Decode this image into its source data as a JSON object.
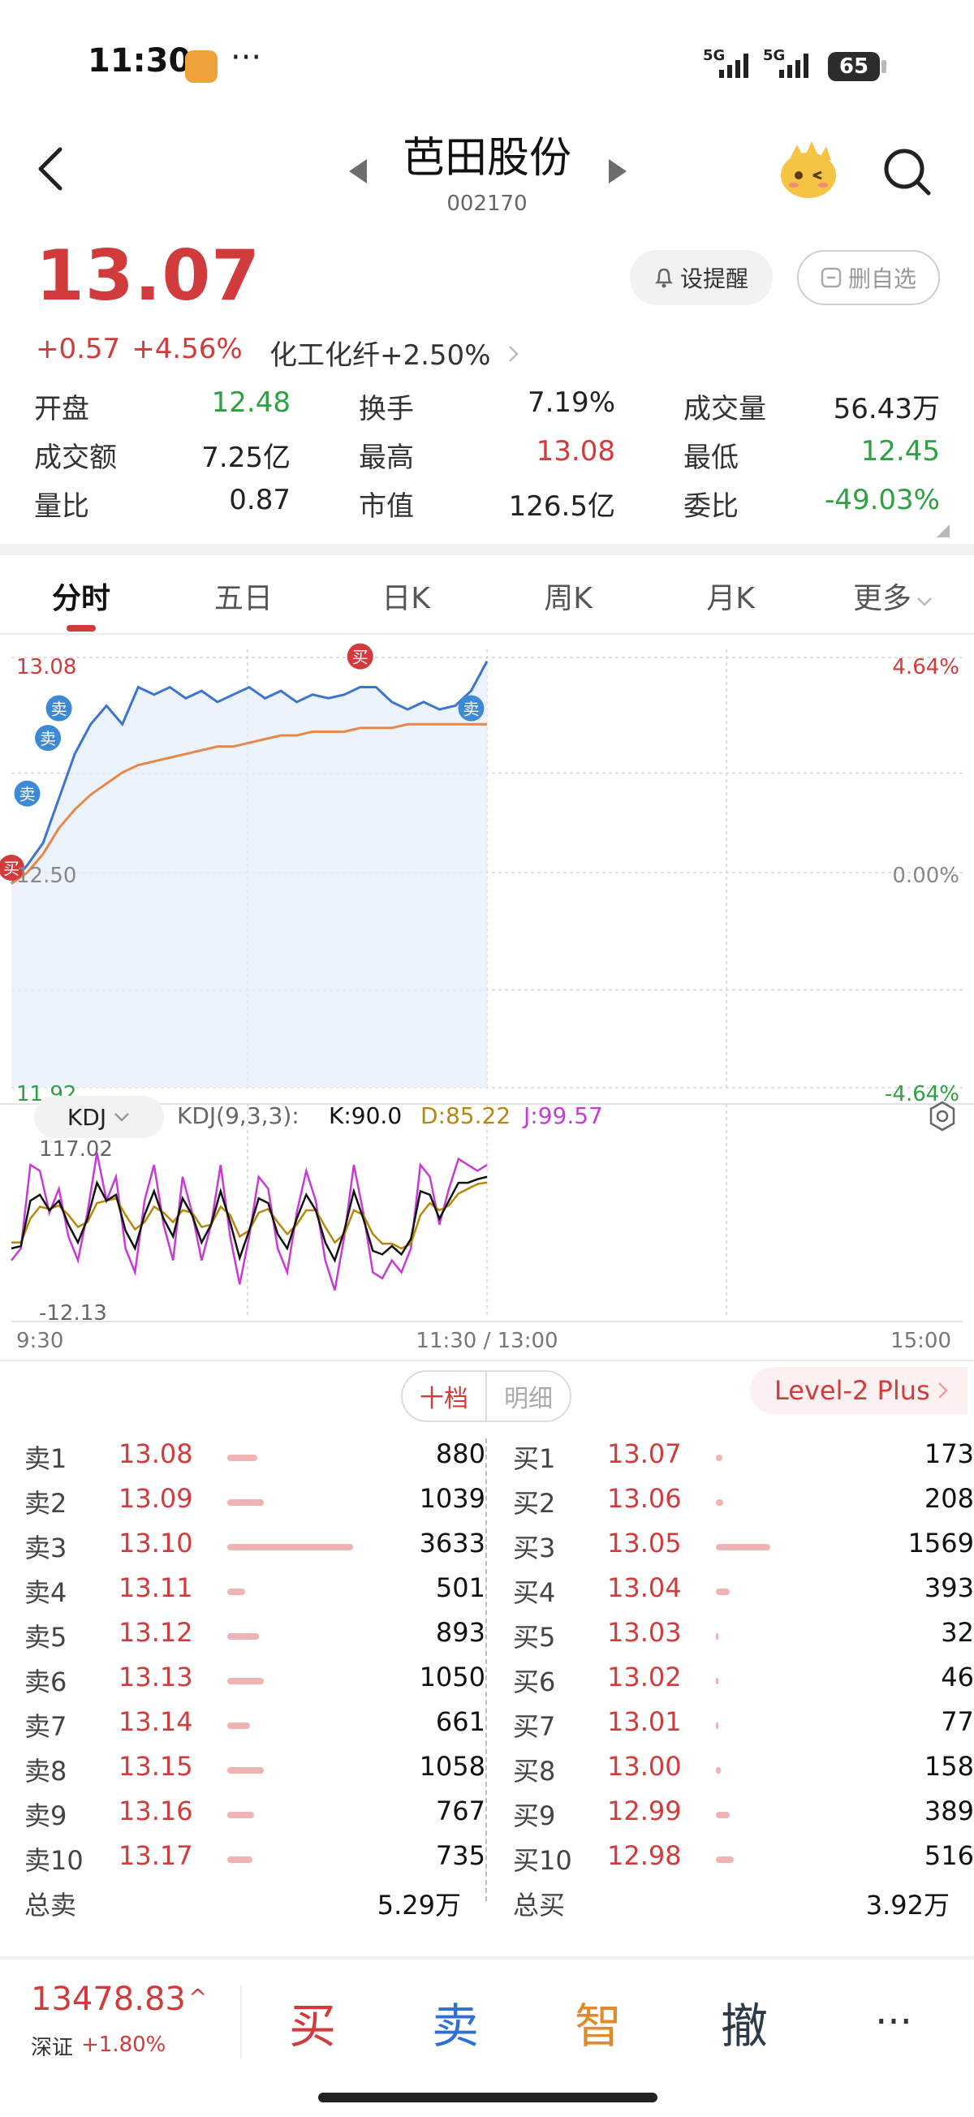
{
  "status": {
    "time": "11:30",
    "dots": "···",
    "net1": "5G",
    "net2": "5G",
    "battery": "65"
  },
  "header": {
    "name": "芭田股份",
    "code": "002170"
  },
  "price": {
    "last": "13.07",
    "change": "+0.57",
    "pct": "+4.56%",
    "sector": "化工化纤+2.50%",
    "alert_label": "设提醒",
    "watch_label": "删自选"
  },
  "quote": [
    {
      "label": "开盘",
      "value": "12.48",
      "color": "green"
    },
    {
      "label": "换手",
      "value": "7.19%",
      "color": "black"
    },
    {
      "label": "成交量",
      "value": "56.43万",
      "color": "black"
    },
    {
      "label": "成交额",
      "value": "7.25亿",
      "color": "black"
    },
    {
      "label": "最高",
      "value": "13.08",
      "color": "red"
    },
    {
      "label": "最低",
      "value": "12.45",
      "color": "green"
    },
    {
      "label": "量比",
      "value": "0.87",
      "color": "black"
    },
    {
      "label": "市值",
      "value": "126.5亿",
      "color": "black"
    },
    {
      "label": "委比",
      "value": "-49.03%",
      "color": "green"
    }
  ],
  "tabs": [
    "分时",
    "五日",
    "日K",
    "周K",
    "月K",
    "更多"
  ],
  "chart_data": {
    "type": "line",
    "y_left_ticks": [
      "13.08",
      "12.50",
      "11.92"
    ],
    "y_right_ticks": [
      "4.64%",
      "0.00%",
      "-4.64%"
    ],
    "x_ticks": [
      "9:30",
      "11:30 / 13:00",
      "15:00"
    ],
    "ylim": [
      11.92,
      13.08
    ],
    "series": [
      {
        "values": [
          12.47,
          12.52,
          12.58,
          12.7,
          12.82,
          12.9,
          12.95,
          12.9,
          13.0,
          12.98,
          13.0,
          12.97,
          12.99,
          12.96,
          12.98,
          13.0,
          12.97,
          12.99,
          12.96,
          12.98,
          12.97,
          12.98,
          13.0,
          13.0,
          12.96,
          12.94,
          12.96,
          12.94,
          12.95,
          12.99,
          13.07
        ]
      },
      {
        "values": [
          12.47,
          12.5,
          12.55,
          12.62,
          12.67,
          12.71,
          12.74,
          12.77,
          12.79,
          12.8,
          12.81,
          12.82,
          12.83,
          12.84,
          12.84,
          12.85,
          12.86,
          12.87,
          12.87,
          12.88,
          12.88,
          12.88,
          12.89,
          12.89,
          12.89,
          12.9,
          12.9,
          12.9,
          12.9,
          12.9,
          12.9
        ]
      }
    ],
    "markers": [
      "买",
      "卖",
      "卖",
      "卖",
      "买",
      "卖"
    ]
  },
  "kdj": {
    "pill": "KDJ",
    "params": "KDJ(9,3,3):",
    "k": "K:90.0",
    "d": "D:85.22",
    "j": "J:99.57",
    "max": "117.02",
    "min": "-12.13"
  },
  "kdj_chart": {
    "ylim": [
      -12.13,
      117.02
    ],
    "j": [
      20,
      30,
      100,
      95,
      60,
      80,
      40,
      20,
      60,
      110,
      70,
      90,
      30,
      10,
      70,
      100,
      50,
      20,
      90,
      60,
      20,
      50,
      100,
      40,
      0,
      40,
      90,
      80,
      30,
      10,
      60,
      95,
      70,
      20,
      -5,
      40,
      100,
      60,
      10,
      5,
      20,
      10,
      30,
      100,
      90,
      50,
      80,
      105,
      100,
      95,
      100
    ],
    "k": [
      30,
      32,
      70,
      75,
      62,
      70,
      50,
      35,
      55,
      85,
      70,
      75,
      45,
      30,
      58,
      78,
      55,
      40,
      72,
      58,
      35,
      50,
      78,
      52,
      22,
      45,
      72,
      68,
      42,
      30,
      55,
      75,
      62,
      35,
      20,
      45,
      78,
      55,
      28,
      25,
      32,
      25,
      38,
      78,
      75,
      55,
      70,
      85,
      85,
      88,
      90
    ],
    "d": [
      35,
      35,
      55,
      65,
      63,
      66,
      58,
      48,
      52,
      68,
      70,
      72,
      58,
      46,
      52,
      65,
      60,
      52,
      62,
      60,
      48,
      50,
      65,
      58,
      40,
      45,
      60,
      63,
      52,
      42,
      50,
      62,
      62,
      48,
      35,
      42,
      62,
      58,
      42,
      34,
      34,
      30,
      34,
      58,
      68,
      62,
      66,
      76,
      80,
      84,
      85.22
    ]
  },
  "orderbook": {
    "seg_ten": "十档",
    "seg_detail": "明细",
    "level2": "Level-2 Plus",
    "sell": [
      {
        "label": "卖1",
        "price": "13.08",
        "vol": "880",
        "ratio": 0.24
      },
      {
        "label": "卖2",
        "price": "13.09",
        "vol": "1039",
        "ratio": 0.29
      },
      {
        "label": "卖3",
        "price": "13.10",
        "vol": "3633",
        "ratio": 1.0
      },
      {
        "label": "卖4",
        "price": "13.11",
        "vol": "501",
        "ratio": 0.14
      },
      {
        "label": "卖5",
        "price": "13.12",
        "vol": "893",
        "ratio": 0.25
      },
      {
        "label": "卖6",
        "price": "13.13",
        "vol": "1050",
        "ratio": 0.29
      },
      {
        "label": "卖7",
        "price": "13.14",
        "vol": "661",
        "ratio": 0.18
      },
      {
        "label": "卖8",
        "price": "13.15",
        "vol": "1058",
        "ratio": 0.29
      },
      {
        "label": "卖9",
        "price": "13.16",
        "vol": "767",
        "ratio": 0.21
      },
      {
        "label": "卖10",
        "price": "13.17",
        "vol": "735",
        "ratio": 0.2
      }
    ],
    "buy": [
      {
        "label": "买1",
        "price": "13.07",
        "vol": "173",
        "ratio": 0.05
      },
      {
        "label": "买2",
        "price": "13.06",
        "vol": "208",
        "ratio": 0.06
      },
      {
        "label": "买3",
        "price": "13.05",
        "vol": "1569",
        "ratio": 0.43
      },
      {
        "label": "买4",
        "price": "13.04",
        "vol": "393",
        "ratio": 0.11
      },
      {
        "label": "买5",
        "price": "13.03",
        "vol": "32",
        "ratio": 0.01
      },
      {
        "label": "买6",
        "price": "13.02",
        "vol": "46",
        "ratio": 0.01
      },
      {
        "label": "买7",
        "price": "13.01",
        "vol": "77",
        "ratio": 0.02
      },
      {
        "label": "买8",
        "price": "13.00",
        "vol": "158",
        "ratio": 0.04
      },
      {
        "label": "买9",
        "price": "12.99",
        "vol": "389",
        "ratio": 0.11
      },
      {
        "label": "买10",
        "price": "12.98",
        "vol": "516",
        "ratio": 0.14
      }
    ],
    "total_sell_label": "总卖",
    "total_sell": "5.29万",
    "total_buy_label": "总买",
    "total_buy": "3.92万"
  },
  "bottom": {
    "index_val": "13478.83",
    "index_arrow": "^",
    "index_name": "深证",
    "index_chg": "+1.80%",
    "buy": "买",
    "sell": "卖",
    "smart": "智",
    "cancel": "撤",
    "more": "···"
  }
}
